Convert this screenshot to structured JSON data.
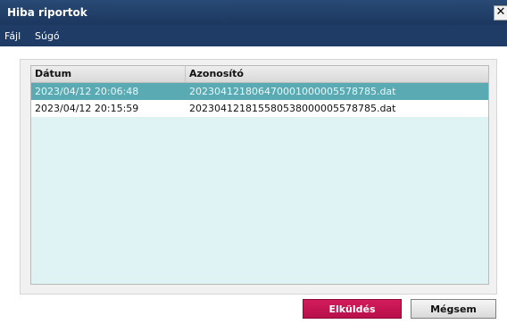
{
  "window": {
    "title": "Hiba riportok",
    "close_label": "✕"
  },
  "menu": {
    "items": [
      "Fájl",
      "Súgó"
    ]
  },
  "table": {
    "columns": [
      "Dátum",
      "Azonosító"
    ],
    "rows": [
      {
        "date": "2023/04/12 20:06:48",
        "id": "20230412180647000100000557878 5.dat",
        "selected": true
      },
      {
        "date": "2023/04/12 20:15:59",
        "id": "20230412181558053800000557878 5.dat",
        "selected": false
      }
    ]
  },
  "buttons": {
    "send": "Elküldés",
    "cancel": "Mégsem"
  },
  "colors": {
    "titlebar": "#1f3c66",
    "selected_row": "#5aaab4",
    "table_bg": "#dff3f5",
    "send_button": "#c8164f"
  }
}
